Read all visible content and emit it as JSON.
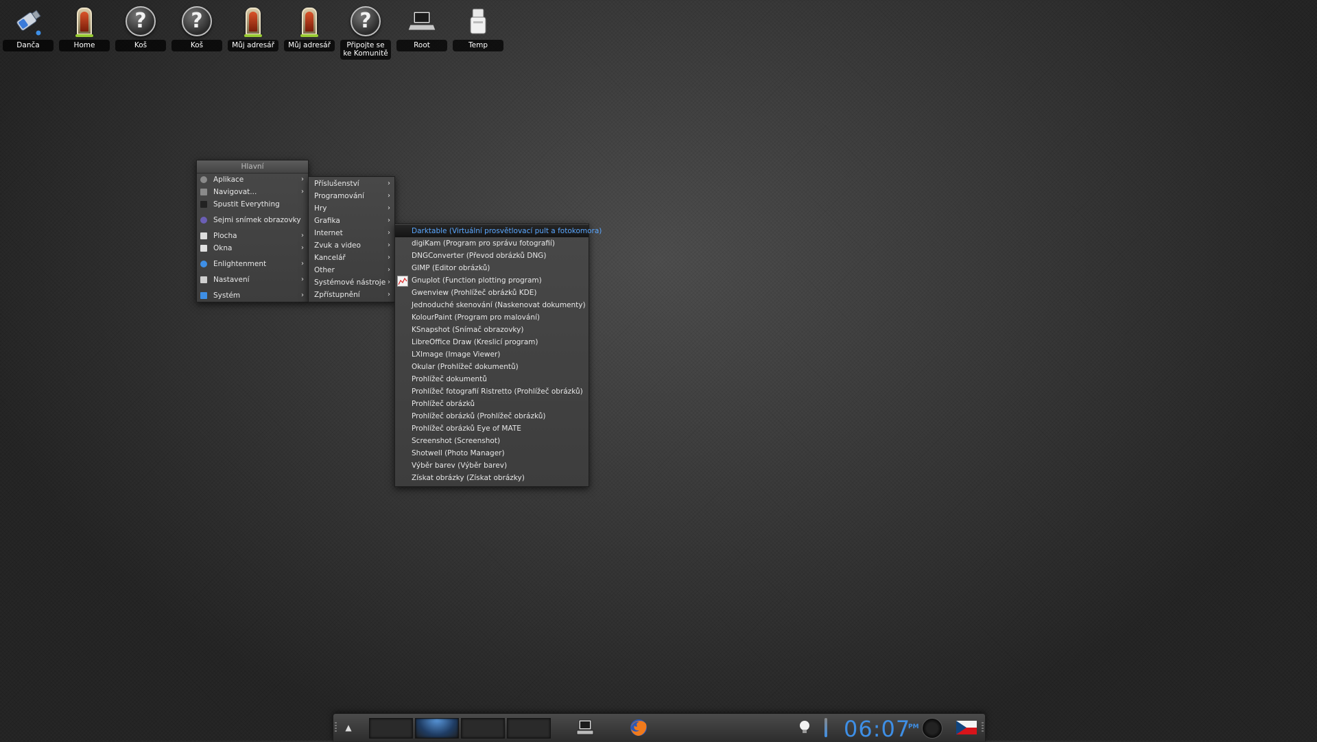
{
  "desktop_icons": [
    {
      "label": "Danča",
      "icon": "usb-drive-icon"
    },
    {
      "label": "Home",
      "icon": "home-door-icon"
    },
    {
      "label": "Koš",
      "icon": "unknown-question-icon"
    },
    {
      "label": "Koš",
      "icon": "unknown-question-icon"
    },
    {
      "label": "Můj adresář",
      "icon": "home-door-icon"
    },
    {
      "label": "Můj adresář",
      "icon": "home-door-icon"
    },
    {
      "label": "Připojte se ke Komunitě",
      "icon": "unknown-question-icon"
    },
    {
      "label": "Root",
      "icon": "computer-icon"
    },
    {
      "label": "Temp",
      "icon": "drive-icon"
    }
  ],
  "main_menu": {
    "title": "Hlavní",
    "items": [
      {
        "label": "Aplikace",
        "submenu": true
      },
      {
        "label": "Navigovat...",
        "submenu": true
      },
      {
        "label": "Spustit Everything",
        "submenu": false
      },
      {
        "label": "Sejmi snímek obrazovky",
        "submenu": false
      },
      {
        "label": "Plocha",
        "submenu": true
      },
      {
        "label": "Okna",
        "submenu": true
      },
      {
        "label": "Enlightenment",
        "submenu": true
      },
      {
        "label": "Nastavení",
        "submenu": true
      },
      {
        "label": "Systém",
        "submenu": true
      }
    ]
  },
  "apps_menu": {
    "items": [
      "Příslušenství",
      "Programování",
      "Hry",
      "Grafika",
      "Internet",
      "Zvuk a video",
      "Kancelář",
      "Other",
      "Systémové nástroje",
      "Zpřístupnění"
    ]
  },
  "graphics_menu": {
    "active_index": 0,
    "items": [
      "Darktable (Virtuální prosvětlovací pult a fotokomora)",
      "digiKam (Program pro správu fotografií)",
      "DNGConverter (Převod obrázků DNG)",
      "GIMP (Editor obrázků)",
      "Gnuplot (Function plotting program)",
      "Gwenview (Prohlížeč obrázků KDE)",
      "Jednoduché skenování (Naskenovat dokumenty)",
      "KolourPaint (Program pro malování)",
      "KSnapshot (Snímač obrazovky)",
      "LibreOffice Draw (Kreslicí program)",
      "LXImage (Image Viewer)",
      "Okular (Prohlížeč dokumentů)",
      "Prohlížeč dokumentů",
      "Prohlížeč fotografií Ristretto (Prohlížeč obrázků)",
      "Prohlížeč obrázků",
      "Prohlížeč obrázků (Prohlížeč obrázků)",
      "Prohlížeč obrázků Eye of MATE",
      "Screenshot (Screenshot)",
      "Shotwell (Photo Manager)",
      "Výběr barev (Výběr barev)",
      "Získat obrázky (Získat obrázky)"
    ]
  },
  "shelf": {
    "clock": "06:07",
    "ampm": "PM",
    "pager_active_index": 1,
    "accent_color": "#3e8fe6",
    "keyboard_layout_icon": "czech-flag-icon"
  }
}
